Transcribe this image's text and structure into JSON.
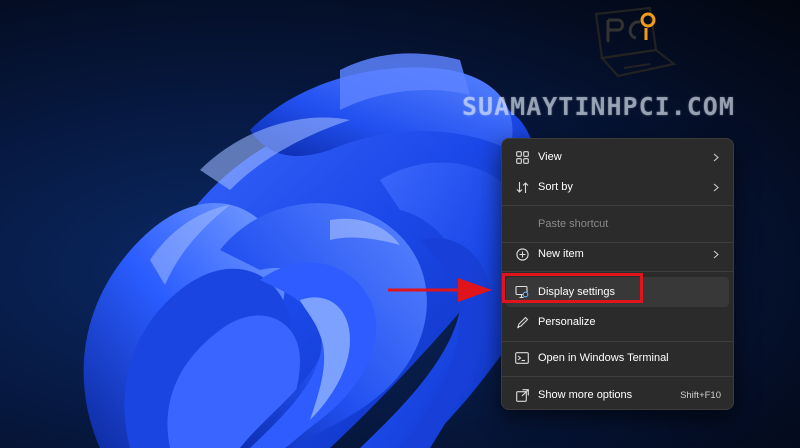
{
  "watermark": {
    "logo_icon": "pci-laptop-logo-icon",
    "text": "SUAMAYTINHPCI.COM"
  },
  "context_menu": {
    "items": [
      {
        "name": "view",
        "label": "View",
        "icon": "grid-view-icon",
        "submenu": true
      },
      {
        "name": "sort-by",
        "label": "Sort by",
        "icon": "sort-arrows-icon",
        "submenu": true
      },
      {
        "name": "paste-shortcut",
        "label": "Paste shortcut",
        "disabled": true
      },
      {
        "name": "new-item",
        "label": "New item",
        "icon": "plus-circle-icon",
        "submenu": true
      },
      {
        "name": "display-settings",
        "label": "Display settings",
        "icon": "monitor-settings-icon",
        "hovered": true
      },
      {
        "name": "personalize",
        "label": "Personalize",
        "icon": "pen-icon"
      },
      {
        "name": "open-terminal",
        "label": "Open in Windows Terminal",
        "icon": "terminal-icon"
      },
      {
        "name": "show-more-options",
        "label": "Show more options",
        "icon": "external-window-icon",
        "shortcut": "Shift+F10"
      }
    ]
  },
  "annotation": {
    "arrow_color": "#e0141c",
    "highlight_color": "#e0141c",
    "highlighted_item": "Display settings"
  },
  "colors": {
    "menu_bg": "#2b2b2b",
    "menu_text": "#ffffff",
    "disabled_text": "#8a8a8a",
    "wallpaper_bloom": "#1a47e6"
  }
}
